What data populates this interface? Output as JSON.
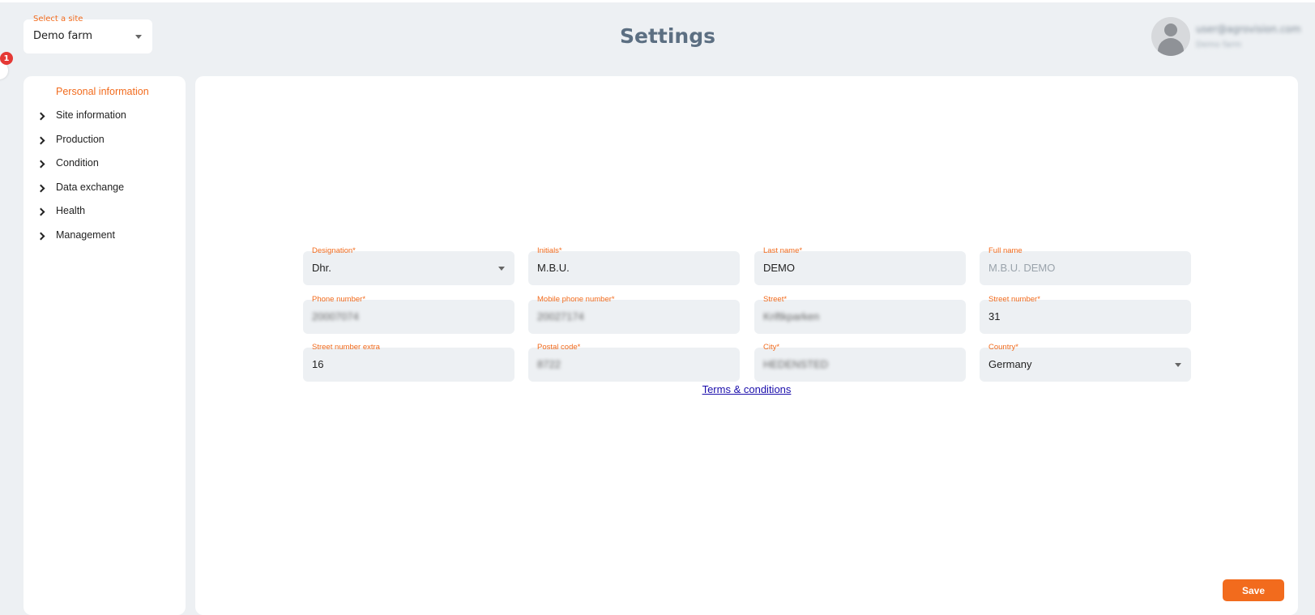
{
  "site_select": {
    "label": "Select a site",
    "value": "Demo farm"
  },
  "page_title": "Settings",
  "user": {
    "email": "user@agrovision.com",
    "site": "Demo farm"
  },
  "notification_count": "1",
  "sidebar": {
    "items": [
      {
        "label": "Personal information",
        "active": true
      },
      {
        "label": "Site information"
      },
      {
        "label": "Production"
      },
      {
        "label": "Condition"
      },
      {
        "label": "Data exchange"
      },
      {
        "label": "Health"
      },
      {
        "label": "Management"
      }
    ]
  },
  "form": {
    "designation": {
      "label": "Designation*",
      "value": "Dhr."
    },
    "initials": {
      "label": "Initials*",
      "value": "M.B.U."
    },
    "last_name": {
      "label": "Last name*",
      "value": "DEMO"
    },
    "full_name": {
      "label": "Full name",
      "value": "M.B.U. DEMO"
    },
    "phone": {
      "label": "Phone number*",
      "value": "20007074"
    },
    "mobile": {
      "label": "Mobile phone number*",
      "value": "20027174"
    },
    "street": {
      "label": "Street*",
      "value": "Kriftkparken"
    },
    "street_number": {
      "label": "Street number*",
      "value": "31"
    },
    "street_number_extra": {
      "label": "Street number extra",
      "value": "16"
    },
    "postal_code": {
      "label": "Postal code*",
      "value": "8722"
    },
    "city": {
      "label": "City*",
      "value": "HEDENSTED"
    },
    "country": {
      "label": "Country*",
      "value": "Germany"
    }
  },
  "terms_link": "Terms & conditions",
  "save_label": "Save",
  "colors": {
    "accent": "#f26b1d",
    "background": "#edf0f3",
    "badge": "#e53935"
  }
}
